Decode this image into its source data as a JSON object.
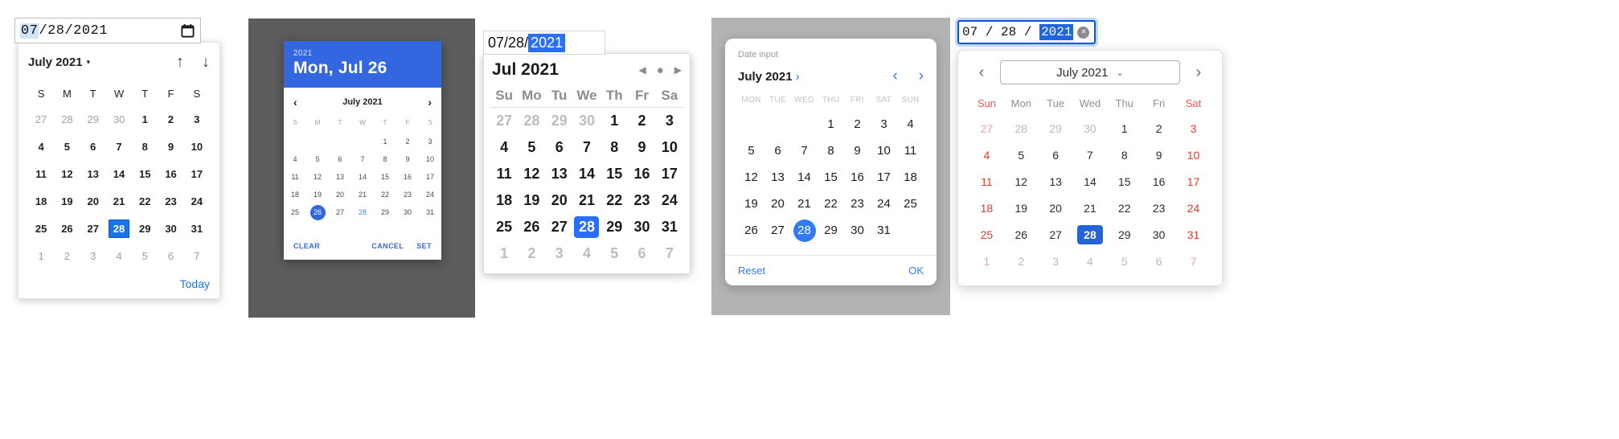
{
  "common": {
    "accent_blue": "#1a73e8",
    "material_blue": "#3367e0",
    "ios_blue": "#2f7bf6",
    "firefox_blue": "#2563d8",
    "weekend_red": "#e03a2f"
  },
  "picker1": {
    "name": "chrome-date-picker",
    "input": {
      "month": "07",
      "sep1": "/",
      "day": "28",
      "sep2": "/",
      "year": "2021",
      "calendar_icon": "calendar-icon"
    },
    "header": {
      "title": "July 2021",
      "caret": "▾",
      "up_arrow": "↑",
      "down_arrow": "↓"
    },
    "weekdays": [
      "S",
      "M",
      "T",
      "W",
      "T",
      "F",
      "S"
    ],
    "weeks": [
      [
        {
          "d": "27",
          "o": true
        },
        {
          "d": "28",
          "o": true
        },
        {
          "d": "29",
          "o": true
        },
        {
          "d": "30",
          "o": true
        },
        {
          "d": "1"
        },
        {
          "d": "2"
        },
        {
          "d": "3"
        }
      ],
      [
        {
          "d": "4"
        },
        {
          "d": "5"
        },
        {
          "d": "6"
        },
        {
          "d": "7"
        },
        {
          "d": "8"
        },
        {
          "d": "9"
        },
        {
          "d": "10"
        }
      ],
      [
        {
          "d": "11"
        },
        {
          "d": "12"
        },
        {
          "d": "13"
        },
        {
          "d": "14"
        },
        {
          "d": "15"
        },
        {
          "d": "16"
        },
        {
          "d": "17"
        }
      ],
      [
        {
          "d": "18"
        },
        {
          "d": "19"
        },
        {
          "d": "20"
        },
        {
          "d": "21"
        },
        {
          "d": "22"
        },
        {
          "d": "23"
        },
        {
          "d": "24"
        }
      ],
      [
        {
          "d": "25"
        },
        {
          "d": "26"
        },
        {
          "d": "27"
        },
        {
          "d": "28",
          "sel": true
        },
        {
          "d": "29"
        },
        {
          "d": "30"
        },
        {
          "d": "31"
        }
      ],
      [
        {
          "d": "1",
          "o": true
        },
        {
          "d": "2",
          "o": true
        },
        {
          "d": "3",
          "o": true
        },
        {
          "d": "4",
          "o": true
        },
        {
          "d": "5",
          "o": true
        },
        {
          "d": "6",
          "o": true
        },
        {
          "d": "7",
          "o": true
        }
      ]
    ],
    "today_label": "Today"
  },
  "picker2": {
    "name": "material-date-picker",
    "header": {
      "year": "2021",
      "date": "Mon, Jul 26"
    },
    "nav": {
      "prev": "‹",
      "title": "July 2021",
      "next": "›"
    },
    "weekdays": [
      "S",
      "M",
      "T",
      "W",
      "T",
      "F",
      "S"
    ],
    "weeks": [
      [
        {
          "d": ""
        },
        {
          "d": ""
        },
        {
          "d": ""
        },
        {
          "d": ""
        },
        {
          "d": "1"
        },
        {
          "d": "2"
        },
        {
          "d": "3"
        }
      ],
      [
        {
          "d": "4"
        },
        {
          "d": "5"
        },
        {
          "d": "6"
        },
        {
          "d": "7"
        },
        {
          "d": "8"
        },
        {
          "d": "9"
        },
        {
          "d": "10"
        }
      ],
      [
        {
          "d": "11"
        },
        {
          "d": "12"
        },
        {
          "d": "13"
        },
        {
          "d": "14"
        },
        {
          "d": "15"
        },
        {
          "d": "16"
        },
        {
          "d": "17"
        }
      ],
      [
        {
          "d": "18"
        },
        {
          "d": "19"
        },
        {
          "d": "20"
        },
        {
          "d": "21"
        },
        {
          "d": "22"
        },
        {
          "d": "23"
        },
        {
          "d": "24"
        }
      ],
      [
        {
          "d": "25"
        },
        {
          "d": "26",
          "sel": true
        },
        {
          "d": "27"
        },
        {
          "d": "28",
          "today": true
        },
        {
          "d": "29"
        },
        {
          "d": "30"
        },
        {
          "d": "31"
        }
      ]
    ],
    "buttons": {
      "clear": "CLEAR",
      "cancel": "CANCEL",
      "set": "SET"
    }
  },
  "picker3": {
    "name": "safari-date-picker",
    "input": {
      "month": "07",
      "sep1": "/",
      "day": "28",
      "sep2": "/",
      "year": "2021"
    },
    "header": {
      "title": "Jul 2021",
      "prev": "◀",
      "stop": "●",
      "next": "▶"
    },
    "weekdays": [
      "Su",
      "Mo",
      "Tu",
      "We",
      "Th",
      "Fr",
      "Sa"
    ],
    "weeks": [
      [
        {
          "d": "27",
          "o": true
        },
        {
          "d": "28",
          "o": true
        },
        {
          "d": "29",
          "o": true
        },
        {
          "d": "30",
          "o": true
        },
        {
          "d": "1"
        },
        {
          "d": "2"
        },
        {
          "d": "3"
        }
      ],
      [
        {
          "d": "4"
        },
        {
          "d": "5"
        },
        {
          "d": "6"
        },
        {
          "d": "7"
        },
        {
          "d": "8"
        },
        {
          "d": "9"
        },
        {
          "d": "10"
        }
      ],
      [
        {
          "d": "11"
        },
        {
          "d": "12"
        },
        {
          "d": "13"
        },
        {
          "d": "14"
        },
        {
          "d": "15"
        },
        {
          "d": "16"
        },
        {
          "d": "17"
        }
      ],
      [
        {
          "d": "18"
        },
        {
          "d": "19"
        },
        {
          "d": "20"
        },
        {
          "d": "21"
        },
        {
          "d": "22"
        },
        {
          "d": "23"
        },
        {
          "d": "24"
        }
      ],
      [
        {
          "d": "25"
        },
        {
          "d": "26"
        },
        {
          "d": "27"
        },
        {
          "d": "28",
          "sel": true
        },
        {
          "d": "29"
        },
        {
          "d": "30"
        },
        {
          "d": "31"
        }
      ],
      [
        {
          "d": "1",
          "o": true
        },
        {
          "d": "2",
          "o": true
        },
        {
          "d": "3",
          "o": true
        },
        {
          "d": "4",
          "o": true
        },
        {
          "d": "5",
          "o": true
        },
        {
          "d": "6",
          "o": true
        },
        {
          "d": "7",
          "o": true
        }
      ]
    ]
  },
  "picker4": {
    "name": "ios-date-picker",
    "label": "Date input",
    "nav": {
      "title": "July 2021",
      "expand": "›",
      "prev": "‹",
      "next": "›"
    },
    "weekdays": [
      "MON",
      "TUE",
      "WED",
      "THU",
      "FRI",
      "SAT",
      "SUN"
    ],
    "weeks": [
      [
        {
          "d": ""
        },
        {
          "d": ""
        },
        {
          "d": ""
        },
        {
          "d": "1"
        },
        {
          "d": "2"
        },
        {
          "d": "3"
        },
        {
          "d": "4"
        }
      ],
      [
        {
          "d": "5"
        },
        {
          "d": "6"
        },
        {
          "d": "7"
        },
        {
          "d": "8"
        },
        {
          "d": "9"
        },
        {
          "d": "10"
        },
        {
          "d": "11"
        }
      ],
      [
        {
          "d": "12"
        },
        {
          "d": "13"
        },
        {
          "d": "14"
        },
        {
          "d": "15"
        },
        {
          "d": "16"
        },
        {
          "d": "17"
        },
        {
          "d": "18"
        }
      ],
      [
        {
          "d": "19"
        },
        {
          "d": "20"
        },
        {
          "d": "21"
        },
        {
          "d": "22"
        },
        {
          "d": "23"
        },
        {
          "d": "24"
        },
        {
          "d": "25"
        }
      ],
      [
        {
          "d": "26"
        },
        {
          "d": "27"
        },
        {
          "d": "28",
          "sel": true
        },
        {
          "d": "29"
        },
        {
          "d": "30"
        },
        {
          "d": "31"
        },
        {
          "d": ""
        }
      ]
    ],
    "buttons": {
      "reset": "Reset",
      "ok": "OK"
    }
  },
  "picker5": {
    "name": "firefox-date-picker",
    "input": {
      "month": "07",
      "sep1": "/",
      "day": "28",
      "sep2": "/",
      "year": "2021",
      "clear_icon": "✕"
    },
    "nav": {
      "prev": "‹",
      "title": "July 2021",
      "chevron": "⌄",
      "next": "›"
    },
    "weekdays": [
      "Sun",
      "Mon",
      "Tue",
      "Wed",
      "Thu",
      "Fri",
      "Sat"
    ],
    "weeks": [
      [
        {
          "d": "27",
          "o": true,
          "we": true
        },
        {
          "d": "28",
          "o": true
        },
        {
          "d": "29",
          "o": true
        },
        {
          "d": "30",
          "o": true
        },
        {
          "d": "1"
        },
        {
          "d": "2"
        },
        {
          "d": "3",
          "we": true
        }
      ],
      [
        {
          "d": "4",
          "we": true
        },
        {
          "d": "5"
        },
        {
          "d": "6"
        },
        {
          "d": "7"
        },
        {
          "d": "8"
        },
        {
          "d": "9"
        },
        {
          "d": "10",
          "we": true
        }
      ],
      [
        {
          "d": "11",
          "we": true
        },
        {
          "d": "12"
        },
        {
          "d": "13"
        },
        {
          "d": "14"
        },
        {
          "d": "15"
        },
        {
          "d": "16"
        },
        {
          "d": "17",
          "we": true
        }
      ],
      [
        {
          "d": "18",
          "we": true
        },
        {
          "d": "19"
        },
        {
          "d": "20"
        },
        {
          "d": "21"
        },
        {
          "d": "22"
        },
        {
          "d": "23"
        },
        {
          "d": "24",
          "we": true
        }
      ],
      [
        {
          "d": "25",
          "we": true
        },
        {
          "d": "26"
        },
        {
          "d": "27"
        },
        {
          "d": "28",
          "sel": true
        },
        {
          "d": "29"
        },
        {
          "d": "30"
        },
        {
          "d": "31",
          "we": true
        }
      ],
      [
        {
          "d": "1",
          "o": true,
          "we": true
        },
        {
          "d": "2",
          "o": true
        },
        {
          "d": "3",
          "o": true
        },
        {
          "d": "4",
          "o": true
        },
        {
          "d": "5",
          "o": true
        },
        {
          "d": "6",
          "o": true
        },
        {
          "d": "7",
          "o": true,
          "we": true
        }
      ]
    ]
  }
}
